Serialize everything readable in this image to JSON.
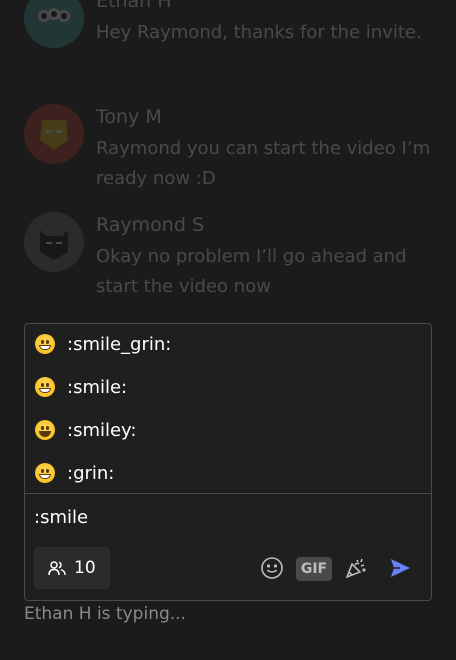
{
  "messages": [
    {
      "name": "Ethan H",
      "text": "Hey Raymond, thanks for the invite."
    },
    {
      "name": "Tony M",
      "text": "Raymond you can start the video I’m ready now :D"
    },
    {
      "name": "Raymond S",
      "text": "Okay no problem I’ll go ahead and start the video now"
    }
  ],
  "suggestions": [
    {
      "label": ":smile_grin:",
      "icon": "grin-emoji-icon"
    },
    {
      "label": ":smile:",
      "icon": "smile-emoji-icon"
    },
    {
      "label": ":smiley:",
      "icon": "smiley-emoji-icon"
    },
    {
      "label": ":grin:",
      "icon": "grin-emoji-icon"
    }
  ],
  "composer": {
    "input_value": ":smile",
    "members_count": "10",
    "gif_label": "GIF"
  },
  "typing_indicator": "Ethan H is typing...",
  "colors": {
    "background": "#1b1b1b",
    "send_accent": "#6a7ff0"
  }
}
